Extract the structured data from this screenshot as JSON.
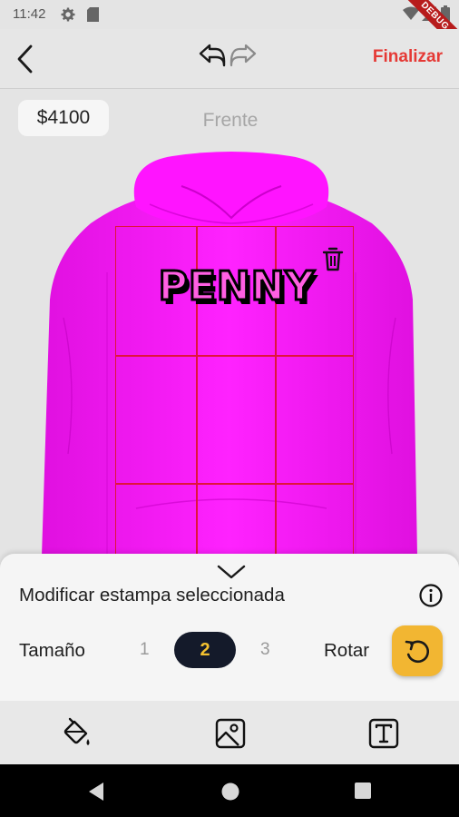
{
  "status_bar": {
    "time": "11:42",
    "icons": [
      "gear-icon",
      "sim-card-icon",
      "wifi-icon",
      "signal-icon",
      "battery-icon"
    ],
    "debug_banner": "DEBUG"
  },
  "app_bar": {
    "back_icon": "chevron-left-icon",
    "undo_icon": "undo-icon",
    "redo_icon": "redo-icon",
    "finalize_label": "Finalizar",
    "finalize_color": "#e53935"
  },
  "editor": {
    "price": "$4100",
    "view_label": "Frente",
    "garment": "hoodie",
    "garment_color": "#ff14ff",
    "grid_color": "#e0143c",
    "print_text": "PENNY",
    "delete_icon": "trash-icon"
  },
  "panel": {
    "collapse_icon": "chevron-down-icon",
    "title": "Modificar estampa seleccionada",
    "info_icon": "info-icon",
    "size_label": "Tamaño",
    "size_options": [
      "1",
      "2",
      "3"
    ],
    "selected_size": "2",
    "rotate_label": "Rotar",
    "rotate_icon": "rotate-icon",
    "accent_color": "#f2b632"
  },
  "toolbar": {
    "tools": [
      "paint-bucket-icon",
      "image-icon",
      "text-icon"
    ]
  },
  "nav_bar": {
    "buttons": [
      "back-triangle-icon",
      "home-circle-icon",
      "recents-square-icon"
    ]
  }
}
